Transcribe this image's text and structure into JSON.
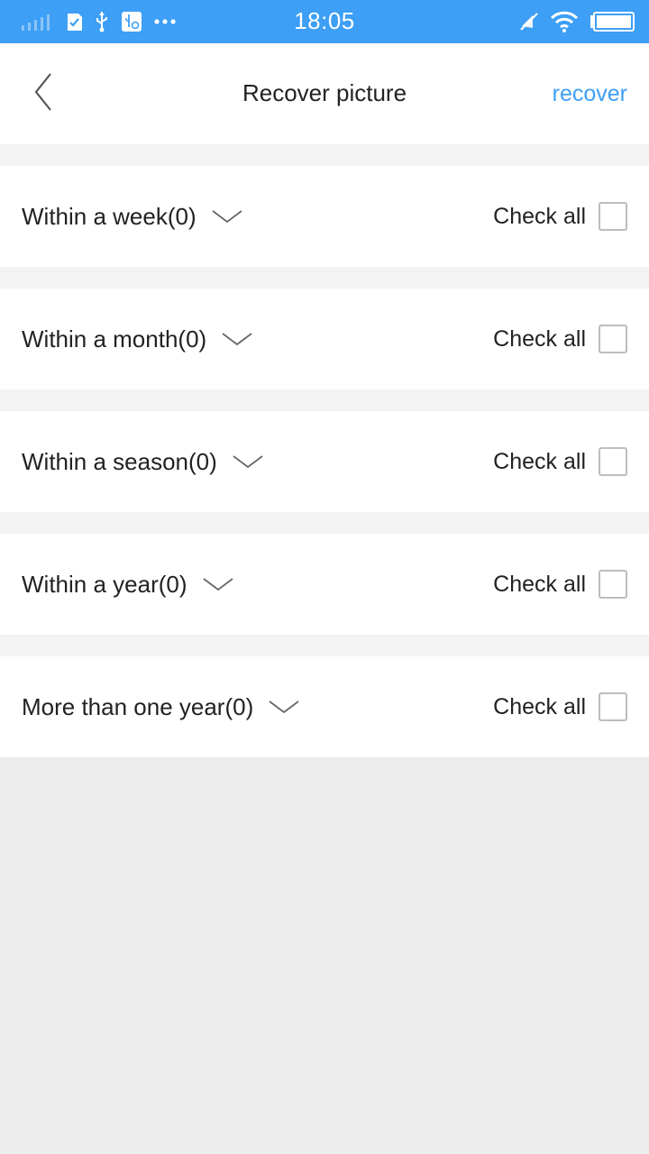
{
  "status_bar": {
    "time": "18:05",
    "icons_left": [
      "signal-icon",
      "check-notification-icon",
      "usb-icon",
      "usb-settings-icon",
      "more-dots-icon"
    ],
    "icons_right": [
      "mute-icon",
      "wifi-icon",
      "battery-icon"
    ]
  },
  "header": {
    "title": "Recover picture",
    "action_label": "recover"
  },
  "groups": [
    {
      "label": "Within a week(0)",
      "check_all_label": "Check all",
      "checked": false
    },
    {
      "label": "Within a month(0)",
      "check_all_label": "Check all",
      "checked": false
    },
    {
      "label": "Within a season(0)",
      "check_all_label": "Check all",
      "checked": false
    },
    {
      "label": "Within a year(0)",
      "check_all_label": "Check all",
      "checked": false
    },
    {
      "label": "More than one year(0)",
      "check_all_label": "Check all",
      "checked": false
    }
  ],
  "colors": {
    "accent": "#3d9ff5",
    "background": "#ececec",
    "separator": "#f3f3f3"
  }
}
